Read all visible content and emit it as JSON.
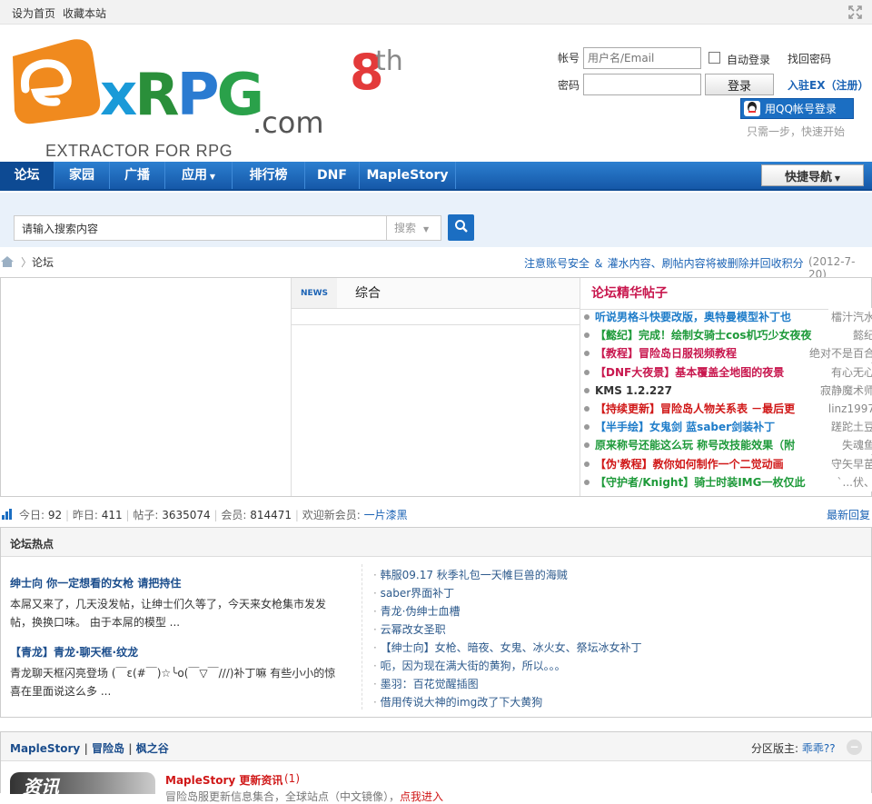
{
  "topbar": {
    "set_home": "设为首页",
    "bookmark": "收藏本站"
  },
  "logo": {
    "text_e": "e",
    "text_xrpg": "xRPG",
    "text_com": ".com",
    "tagline": "EXTRACTOR FOR RPG",
    "anniv_num": "8",
    "anniv_suffix": "th"
  },
  "login": {
    "account_label": "帐号",
    "account_placeholder": "用户名/Email",
    "auto_login": "自动登录",
    "find_password": "找回密码",
    "password_label": "密码",
    "login_button": "登录",
    "register": "入驻EX（注册）",
    "qq_login": "用QQ帐号登录",
    "qq_hint": "只需一步，快速开始"
  },
  "nav": {
    "items": [
      "论坛",
      "家园",
      "广播",
      "应用",
      "排行榜",
      "DNF",
      "MapleStory"
    ],
    "quick_nav": "快捷导航"
  },
  "search": {
    "placeholder": "请输入搜索内容",
    "type": "搜索"
  },
  "crumb": {
    "current": "论坛",
    "notice": "注意账号安全 ＆ 灌水内容、刷帖内容将被删除并回收积分",
    "date": "(2012-7-20)"
  },
  "news": {
    "tag": "NEWS",
    "tab": "综合"
  },
  "picks": {
    "title": "论坛精华帖子",
    "items": [
      {
        "text": "听说男格斗快要改版，奥特曼模型补丁也",
        "author": "檑汁汽水",
        "color": "#1e7cc9"
      },
      {
        "text": "【懿纪】完成！绘制女骑士cos机巧少女夜夜",
        "author": "懿纪",
        "color": "#1e9a3a"
      },
      {
        "text": "【教程】冒险岛日服视频教程",
        "author": "绝对不是百合",
        "color": "#c8174e"
      },
      {
        "text": "【DNF大夜景】基本覆盖全地图的夜景",
        "author": "有心无心",
        "color": "#c8174e"
      },
      {
        "text": "KMS 1.2.227",
        "author": "寂静魔术师",
        "color": "#333333"
      },
      {
        "text": "【持续更新】冒险岛人物关系表 －最后更",
        "author": "linz1997",
        "color": "#d01818"
      },
      {
        "text": "【半手绘】女鬼剑 蓝saber剑装补丁",
        "author": "蹉跎土豆",
        "color": "#1e7cc9"
      },
      {
        "text": "原来称号还能这么玩 称号改技能效果（附",
        "author": "失魂鱼",
        "color": "#1e9a3a"
      },
      {
        "text": "【伪'教程】教你如何制作一个二觉动画",
        "author": "守矢早苗",
        "color": "#d01818"
      },
      {
        "text": "【守护者/Knight】骑士时装IMG一枚仅此",
        "author": "`...伏、",
        "color": "#1e9a3a"
      }
    ]
  },
  "stats": {
    "today_label": "今日:",
    "today": "92",
    "yesterday_label": "昨日:",
    "yesterday": "411",
    "posts_label": "帖子:",
    "posts": "3635074",
    "members_label": "会员:",
    "members": "814471",
    "welcome_label": "欢迎新会员:",
    "newest": "一片漆黑",
    "latest_reply": "最新回复"
  },
  "hot": {
    "title": "论坛热点",
    "topic1": {
      "title": "绅士向 你一定想看的女枪 请把持住",
      "desc": "本屌又来了，几天没发帖，让绅士们久等了，今天来女枪集市发发帖，换换口味。 由于本屌的模型 ..."
    },
    "topic2": {
      "title": "【青龙】青龙·聊天框·纹龙",
      "desc": "青龙聊天框闪亮登场 (￣ε(#￣)☆╰o(￣▽￣///)补丁嘛 有些小小的惊喜在里面说这么多 ..."
    },
    "links": [
      "韩服09.17 秋季礼包一天帷巨兽的海贼",
      "saber界面补丁",
      "青龙·伪绅士血槽",
      "云幂改女圣职",
      "【绅士向】女枪、暗夜、女鬼、冰火女、祭坛冰女补丁",
      "呃，因为现在满大街的黄狗，所以。。。",
      "墨羽：百花觉醒插图",
      "借用传说大神的img改了下大黄狗"
    ]
  },
  "section": {
    "title1": "MapleStory",
    "title2": "冒险岛",
    "title3": "枫之谷",
    "mod_label": "分区版主:",
    "mod": "乖乖??",
    "forum_title": "MapleStory 更新资讯",
    "forum_count": "(1)",
    "forum_desc": "冒险岛服更新信息集合，全球站点（中文镜像），",
    "forum_link": "点我进入",
    "banner": "资讯"
  },
  "colors": {
    "nav_blue": "#1b63b5",
    "pick_title": "#c8174e",
    "link_blue": "#2d5a8c",
    "accent_red": "#d01818"
  }
}
